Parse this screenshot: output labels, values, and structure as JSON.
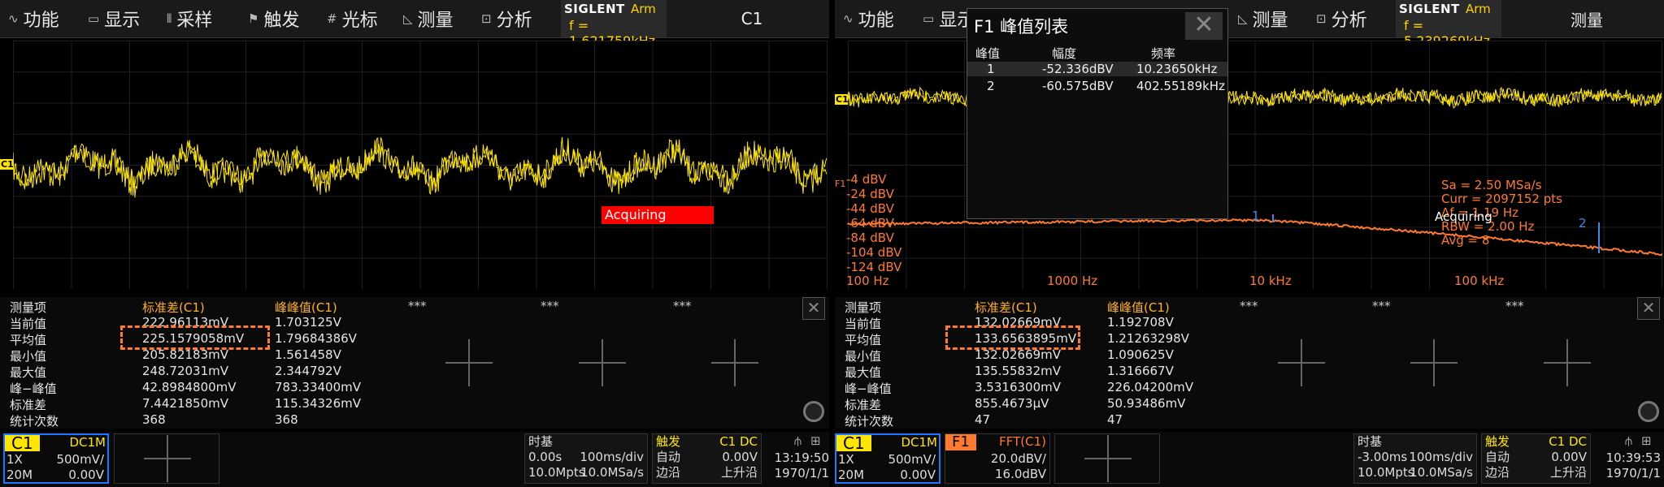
{
  "menu": [
    "功能",
    "显示",
    "采样",
    "触发",
    "光标",
    "测量",
    "分析"
  ],
  "menu_icons": [
    "wave-icon",
    "display-icon",
    "sample-icon",
    "flag-icon",
    "cursor-icon",
    "ruler-icon",
    "analysis-icon"
  ],
  "left": {
    "brand": "SIGLENT",
    "run_state": "Arm",
    "freq": "f = 1.621759kHz",
    "channel_title": "C1",
    "acquiring": "Acquiring",
    "meas_headers": [
      "测量项",
      "标准差(C1)",
      "峰峰值(C1)",
      "***",
      "***",
      "***"
    ],
    "meas_rows": [
      [
        "当前值",
        "222.96113mV",
        "1.703125V"
      ],
      [
        "平均值",
        "225.1579058mV",
        "1.79684386V"
      ],
      [
        "最小值",
        "205.82183mV",
        "1.561458V"
      ],
      [
        "最大值",
        "248.72031mV",
        "2.344792V"
      ],
      [
        "峰−峰值",
        "42.8984800mV",
        "783.33400mV"
      ],
      [
        "标准差",
        "7.4421850mV",
        "115.34326mV"
      ],
      [
        "统计次数",
        "368",
        "368"
      ]
    ],
    "ch_box": {
      "name": "C1",
      "coupling": "DC1M",
      "probe": "1X",
      "scale": "500mV/",
      "bw": "20M",
      "offset": "0.00V"
    },
    "timebase": {
      "label": "时基",
      "delay": "0.00s",
      "tdiv": "100ms/div",
      "mem": "10.0Mpts",
      "rate": "10.0MSa/s"
    },
    "trigger": {
      "label": "触发",
      "src": "C1 DC",
      "mode": "自动",
      "level": "0.00V",
      "type": "边沿",
      "slope": "上升沿"
    },
    "clock": {
      "time": "13:19:50",
      "date": "1970/1/1"
    }
  },
  "right": {
    "brand": "SIGLENT",
    "run_state": "Arm",
    "freq": "f = 5.239269kHz",
    "channel_title": "测量",
    "peak_table": {
      "title": "F1 峰值列表",
      "headers": [
        "峰值",
        "幅度",
        "频率"
      ],
      "rows": [
        [
          "1",
          "-52.336dBV",
          "10.23650kHz"
        ],
        [
          "2",
          "-60.575dBV",
          "402.55189kHz"
        ]
      ]
    },
    "fft_marker": "F1",
    "db_labels": [
      "-4 dBV",
      "-24 dBV",
      "-44 dBV",
      "-64 dBV",
      "-84 dBV",
      "-104 dBV",
      "-124 dBV"
    ],
    "hz_labels": [
      "100 Hz",
      "1000 Hz",
      "10 kHz",
      "100 kHz"
    ],
    "sa_info": [
      "Sa = 2.50 MSa/s",
      "Curr = 2097152 pts",
      "Δf = 1.19 Hz",
      "RBW = 2.00 Hz",
      "Avg = 8"
    ],
    "acquiring": "Acquiring",
    "peak_marks": [
      "1",
      "2"
    ],
    "meas_headers": [
      "测量项",
      "标准差(C1)",
      "峰峰值(C1)",
      "***",
      "***",
      "***"
    ],
    "meas_rows": [
      [
        "当前值",
        "132.02669mV",
        "1.192708V"
      ],
      [
        "平均值",
        "133.6563895mV",
        "1.21263298V"
      ],
      [
        "最小值",
        "132.02669mV",
        "1.090625V"
      ],
      [
        "最大值",
        "135.55832mV",
        "1.316667V"
      ],
      [
        "峰−峰值",
        "3.5316300mV",
        "226.04200mV"
      ],
      [
        "标准差",
        "855.4673μV",
        "50.93486mV"
      ],
      [
        "统计次数",
        "47",
        "47"
      ]
    ],
    "ch_box": {
      "name": "C1",
      "coupling": "DC1M",
      "probe": "1X",
      "scale": "500mV/",
      "bw": "20M",
      "offset": "0.00V"
    },
    "fft_box": {
      "name": "F1",
      "src": "FFT(C1)",
      "scale": "20.0dBV/",
      "offset": "16.0dBV"
    },
    "timebase": {
      "label": "时基",
      "delay": "-3.00ms",
      "tdiv": "100ms/div",
      "mem": "10.0Mpts",
      "rate": "10.0MSa/s"
    },
    "trigger": {
      "label": "触发",
      "src": "C1 DC",
      "mode": "自动",
      "level": "0.00V",
      "type": "边沿",
      "slope": "上升沿"
    },
    "clock": {
      "time": "10:39:53",
      "date": "1970/1/1"
    }
  },
  "colors": {
    "trace": "#ffe600",
    "fft": "#ff7a2e",
    "accent": "#ffd200",
    "header": "#ffb020",
    "highlight": "#ff7a2e",
    "trigger": "#3b8be8"
  }
}
